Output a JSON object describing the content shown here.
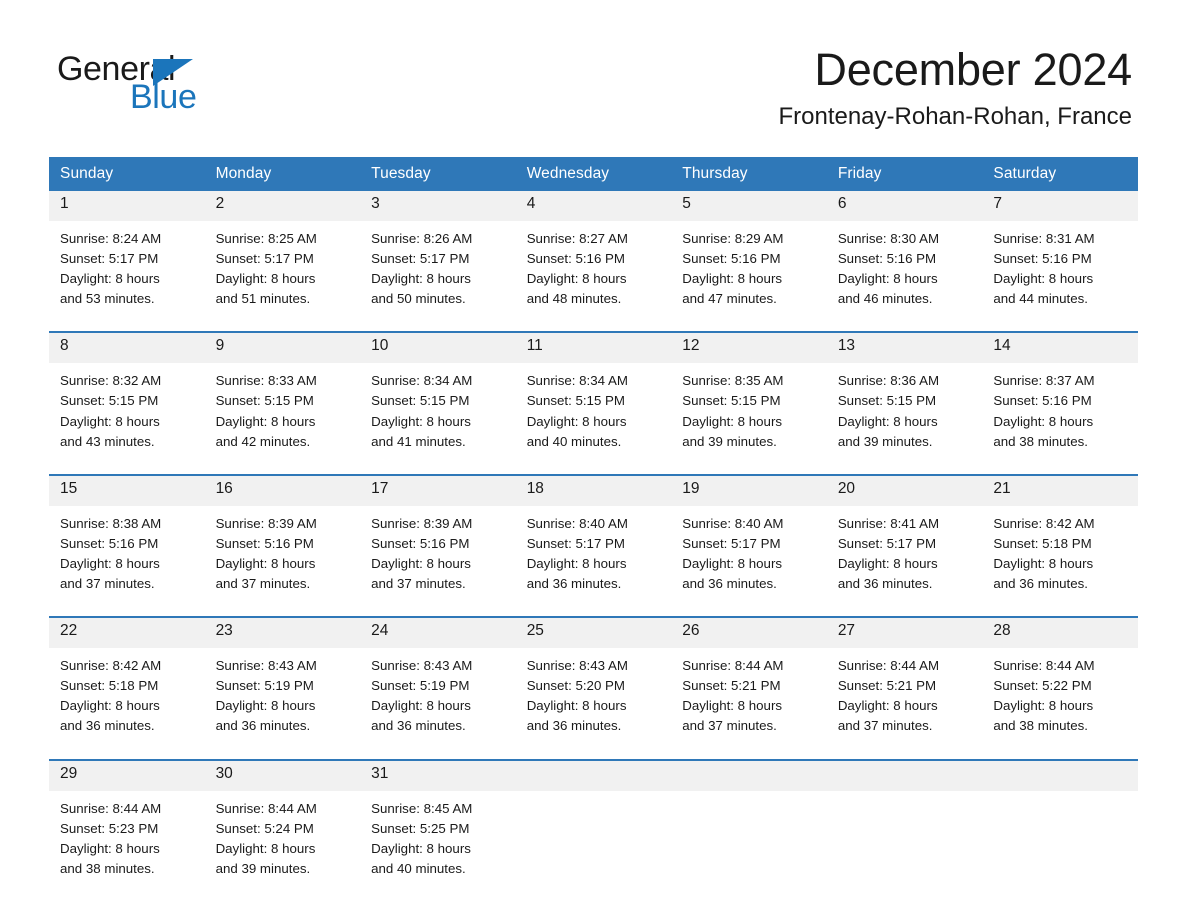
{
  "brand": {
    "name_part1": "General",
    "name_part2": "Blue",
    "logo_icon": "triangle-icon",
    "accent_color": "#1b75bb"
  },
  "header": {
    "month_title": "December 2024",
    "location": "Frontenay-Rohan-Rohan, France"
  },
  "theme": {
    "header_bg": "#2f78b8",
    "daynum_bg": "#f1f1f1",
    "separator": "#2f78b8",
    "text": "#1a1a1a"
  },
  "calendar": {
    "weekday_headers": [
      "Sunday",
      "Monday",
      "Tuesday",
      "Wednesday",
      "Thursday",
      "Friday",
      "Saturday"
    ],
    "weeks": [
      [
        {
          "day": "1",
          "sunrise": "Sunrise: 8:24 AM",
          "sunset": "Sunset: 5:17 PM",
          "daylight_1": "Daylight: 8 hours",
          "daylight_2": "and 53 minutes."
        },
        {
          "day": "2",
          "sunrise": "Sunrise: 8:25 AM",
          "sunset": "Sunset: 5:17 PM",
          "daylight_1": "Daylight: 8 hours",
          "daylight_2": "and 51 minutes."
        },
        {
          "day": "3",
          "sunrise": "Sunrise: 8:26 AM",
          "sunset": "Sunset: 5:17 PM",
          "daylight_1": "Daylight: 8 hours",
          "daylight_2": "and 50 minutes."
        },
        {
          "day": "4",
          "sunrise": "Sunrise: 8:27 AM",
          "sunset": "Sunset: 5:16 PM",
          "daylight_1": "Daylight: 8 hours",
          "daylight_2": "and 48 minutes."
        },
        {
          "day": "5",
          "sunrise": "Sunrise: 8:29 AM",
          "sunset": "Sunset: 5:16 PM",
          "daylight_1": "Daylight: 8 hours",
          "daylight_2": "and 47 minutes."
        },
        {
          "day": "6",
          "sunrise": "Sunrise: 8:30 AM",
          "sunset": "Sunset: 5:16 PM",
          "daylight_1": "Daylight: 8 hours",
          "daylight_2": "and 46 minutes."
        },
        {
          "day": "7",
          "sunrise": "Sunrise: 8:31 AM",
          "sunset": "Sunset: 5:16 PM",
          "daylight_1": "Daylight: 8 hours",
          "daylight_2": "and 44 minutes."
        }
      ],
      [
        {
          "day": "8",
          "sunrise": "Sunrise: 8:32 AM",
          "sunset": "Sunset: 5:15 PM",
          "daylight_1": "Daylight: 8 hours",
          "daylight_2": "and 43 minutes."
        },
        {
          "day": "9",
          "sunrise": "Sunrise: 8:33 AM",
          "sunset": "Sunset: 5:15 PM",
          "daylight_1": "Daylight: 8 hours",
          "daylight_2": "and 42 minutes."
        },
        {
          "day": "10",
          "sunrise": "Sunrise: 8:34 AM",
          "sunset": "Sunset: 5:15 PM",
          "daylight_1": "Daylight: 8 hours",
          "daylight_2": "and 41 minutes."
        },
        {
          "day": "11",
          "sunrise": "Sunrise: 8:34 AM",
          "sunset": "Sunset: 5:15 PM",
          "daylight_1": "Daylight: 8 hours",
          "daylight_2": "and 40 minutes."
        },
        {
          "day": "12",
          "sunrise": "Sunrise: 8:35 AM",
          "sunset": "Sunset: 5:15 PM",
          "daylight_1": "Daylight: 8 hours",
          "daylight_2": "and 39 minutes."
        },
        {
          "day": "13",
          "sunrise": "Sunrise: 8:36 AM",
          "sunset": "Sunset: 5:15 PM",
          "daylight_1": "Daylight: 8 hours",
          "daylight_2": "and 39 minutes."
        },
        {
          "day": "14",
          "sunrise": "Sunrise: 8:37 AM",
          "sunset": "Sunset: 5:16 PM",
          "daylight_1": "Daylight: 8 hours",
          "daylight_2": "and 38 minutes."
        }
      ],
      [
        {
          "day": "15",
          "sunrise": "Sunrise: 8:38 AM",
          "sunset": "Sunset: 5:16 PM",
          "daylight_1": "Daylight: 8 hours",
          "daylight_2": "and 37 minutes."
        },
        {
          "day": "16",
          "sunrise": "Sunrise: 8:39 AM",
          "sunset": "Sunset: 5:16 PM",
          "daylight_1": "Daylight: 8 hours",
          "daylight_2": "and 37 minutes."
        },
        {
          "day": "17",
          "sunrise": "Sunrise: 8:39 AM",
          "sunset": "Sunset: 5:16 PM",
          "daylight_1": "Daylight: 8 hours",
          "daylight_2": "and 37 minutes."
        },
        {
          "day": "18",
          "sunrise": "Sunrise: 8:40 AM",
          "sunset": "Sunset: 5:17 PM",
          "daylight_1": "Daylight: 8 hours",
          "daylight_2": "and 36 minutes."
        },
        {
          "day": "19",
          "sunrise": "Sunrise: 8:40 AM",
          "sunset": "Sunset: 5:17 PM",
          "daylight_1": "Daylight: 8 hours",
          "daylight_2": "and 36 minutes."
        },
        {
          "day": "20",
          "sunrise": "Sunrise: 8:41 AM",
          "sunset": "Sunset: 5:17 PM",
          "daylight_1": "Daylight: 8 hours",
          "daylight_2": "and 36 minutes."
        },
        {
          "day": "21",
          "sunrise": "Sunrise: 8:42 AM",
          "sunset": "Sunset: 5:18 PM",
          "daylight_1": "Daylight: 8 hours",
          "daylight_2": "and 36 minutes."
        }
      ],
      [
        {
          "day": "22",
          "sunrise": "Sunrise: 8:42 AM",
          "sunset": "Sunset: 5:18 PM",
          "daylight_1": "Daylight: 8 hours",
          "daylight_2": "and 36 minutes."
        },
        {
          "day": "23",
          "sunrise": "Sunrise: 8:43 AM",
          "sunset": "Sunset: 5:19 PM",
          "daylight_1": "Daylight: 8 hours",
          "daylight_2": "and 36 minutes."
        },
        {
          "day": "24",
          "sunrise": "Sunrise: 8:43 AM",
          "sunset": "Sunset: 5:19 PM",
          "daylight_1": "Daylight: 8 hours",
          "daylight_2": "and 36 minutes."
        },
        {
          "day": "25",
          "sunrise": "Sunrise: 8:43 AM",
          "sunset": "Sunset: 5:20 PM",
          "daylight_1": "Daylight: 8 hours",
          "daylight_2": "and 36 minutes."
        },
        {
          "day": "26",
          "sunrise": "Sunrise: 8:44 AM",
          "sunset": "Sunset: 5:21 PM",
          "daylight_1": "Daylight: 8 hours",
          "daylight_2": "and 37 minutes."
        },
        {
          "day": "27",
          "sunrise": "Sunrise: 8:44 AM",
          "sunset": "Sunset: 5:21 PM",
          "daylight_1": "Daylight: 8 hours",
          "daylight_2": "and 37 minutes."
        },
        {
          "day": "28",
          "sunrise": "Sunrise: 8:44 AM",
          "sunset": "Sunset: 5:22 PM",
          "daylight_1": "Daylight: 8 hours",
          "daylight_2": "and 38 minutes."
        }
      ],
      [
        {
          "day": "29",
          "sunrise": "Sunrise: 8:44 AM",
          "sunset": "Sunset: 5:23 PM",
          "daylight_1": "Daylight: 8 hours",
          "daylight_2": "and 38 minutes."
        },
        {
          "day": "30",
          "sunrise": "Sunrise: 8:44 AM",
          "sunset": "Sunset: 5:24 PM",
          "daylight_1": "Daylight: 8 hours",
          "daylight_2": "and 39 minutes."
        },
        {
          "day": "31",
          "sunrise": "Sunrise: 8:45 AM",
          "sunset": "Sunset: 5:25 PM",
          "daylight_1": "Daylight: 8 hours",
          "daylight_2": "and 40 minutes."
        },
        {
          "day": "",
          "sunrise": "",
          "sunset": "",
          "daylight_1": "",
          "daylight_2": ""
        },
        {
          "day": "",
          "sunrise": "",
          "sunset": "",
          "daylight_1": "",
          "daylight_2": ""
        },
        {
          "day": "",
          "sunrise": "",
          "sunset": "",
          "daylight_1": "",
          "daylight_2": ""
        },
        {
          "day": "",
          "sunrise": "",
          "sunset": "",
          "daylight_1": "",
          "daylight_2": ""
        }
      ]
    ]
  }
}
